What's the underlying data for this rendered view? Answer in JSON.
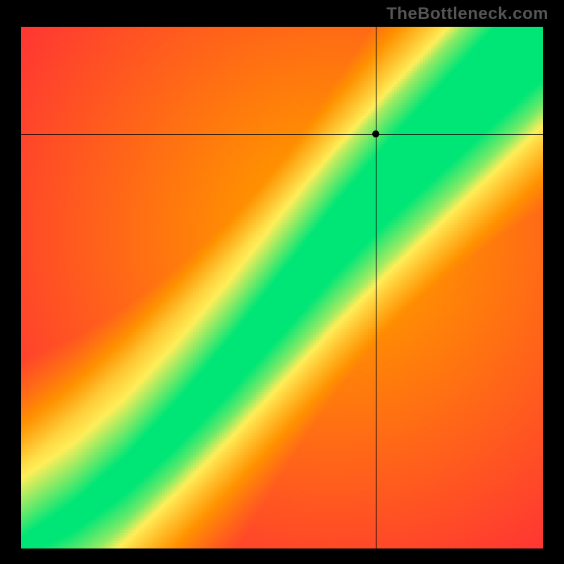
{
  "watermark": "TheBottleneck.com",
  "chart_data": {
    "type": "heatmap",
    "title": "",
    "xlabel": "",
    "ylabel": "",
    "xlim": [
      0,
      1
    ],
    "ylim": [
      0,
      1
    ],
    "marker": {
      "x": 0.68,
      "y": 0.795
    },
    "crosshair": {
      "x": 0.68,
      "y": 0.795
    },
    "optimal_curve": {
      "description": "green ridge of optimal pairing; below = red (bottleneck), above-left = red, band around curve = yellow",
      "points": [
        {
          "x": 0.0,
          "y": 0.0
        },
        {
          "x": 0.1,
          "y": 0.06
        },
        {
          "x": 0.2,
          "y": 0.14
        },
        {
          "x": 0.3,
          "y": 0.24
        },
        {
          "x": 0.4,
          "y": 0.35
        },
        {
          "x": 0.5,
          "y": 0.47
        },
        {
          "x": 0.6,
          "y": 0.59
        },
        {
          "x": 0.7,
          "y": 0.7
        },
        {
          "x": 0.8,
          "y": 0.8
        },
        {
          "x": 0.9,
          "y": 0.9
        },
        {
          "x": 1.0,
          "y": 1.0
        }
      ]
    },
    "color_scale": [
      "#ff1744",
      "#ff9100",
      "#ffee58",
      "#00e676"
    ]
  }
}
